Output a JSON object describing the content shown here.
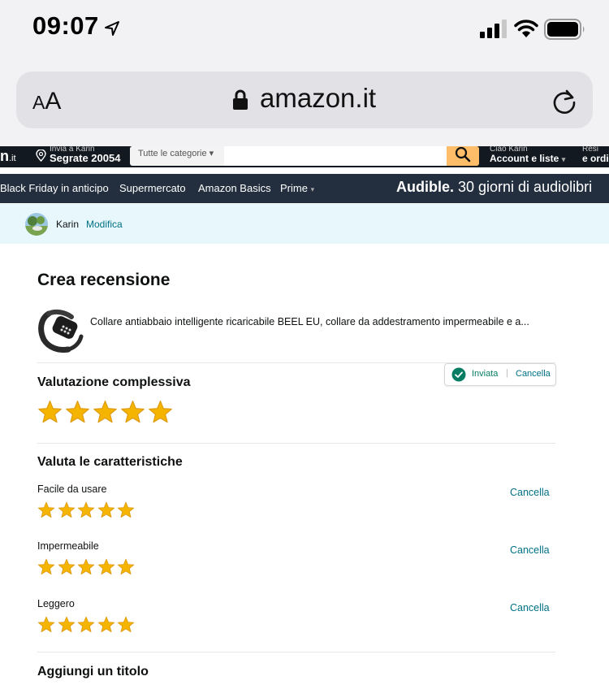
{
  "status_bar": {
    "time": "09:07"
  },
  "browser": {
    "text_size_label_small": "A",
    "text_size_label_large": "A",
    "url": "amazon.it"
  },
  "amazon_nav": {
    "logo_fragment": "n",
    "logo_tld": ".it",
    "deliver_to": "Invia a Karin",
    "deliver_location": "Segrate 20054",
    "search_category": "Tutte le categorie",
    "search_value": "",
    "account_greeting": "Ciao Karin",
    "account_label": "Account e liste",
    "returns_line1": "Resi",
    "returns_line2": "e ordini"
  },
  "subnav": {
    "items": [
      "Black Friday in anticipo",
      "Supermercato",
      "Amazon Basics",
      "Prime"
    ],
    "banner_brand": "Audible.",
    "banner_text": " 30 giorni di audiolibri"
  },
  "profile": {
    "name": "Karin",
    "edit_label": "Modifica"
  },
  "review": {
    "title": "Crea recensione",
    "product_title": "Collare antiabbaio intelligente ricaricabile BEEL EU, collare da addestramento impermeabile e a...",
    "overall": {
      "heading": "Valutazione complessiva",
      "rating": 5,
      "max": 5
    },
    "submission_status": {
      "sent_label": "Inviata",
      "cancel_label": "Cancella"
    },
    "features_heading": "Valuta le caratteristiche",
    "features": [
      {
        "label": "Facile da usare",
        "rating": 5,
        "max": 5,
        "cancel_label": "Cancella"
      },
      {
        "label": "Impermeabile",
        "rating": 5,
        "max": 5,
        "cancel_label": "Cancella"
      },
      {
        "label": "Leggero",
        "rating": 5,
        "max": 5,
        "cancel_label": "Cancella"
      }
    ],
    "add_title_heading": "Aggiungi un titolo"
  },
  "colors": {
    "amazon_dark": "#131921",
    "amazon_subnav": "#232f3e",
    "search_button": "#febd69",
    "link": "#007185",
    "star": "#f4b400",
    "success": "#067d62"
  }
}
